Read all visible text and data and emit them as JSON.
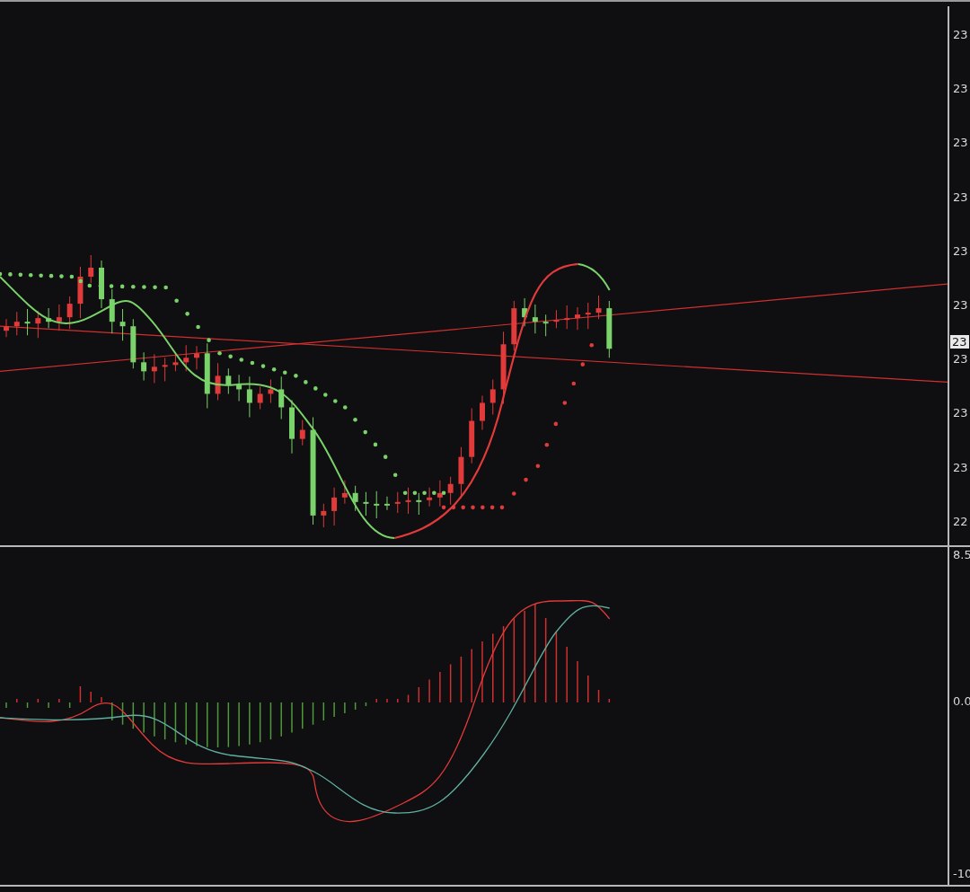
{
  "price_pane": {
    "axis_labels": [
      {
        "text": "23",
        "kind": "tick"
      },
      {
        "text": "23",
        "kind": "tick"
      },
      {
        "text": "23",
        "kind": "tick"
      },
      {
        "text": "23",
        "kind": "tick"
      },
      {
        "text": "23",
        "kind": "tick"
      },
      {
        "text": "23",
        "kind": "tick"
      },
      {
        "text": "23",
        "kind": "current"
      },
      {
        "text": "23",
        "kind": "tick"
      },
      {
        "text": "23",
        "kind": "tick"
      },
      {
        "text": "23",
        "kind": "tick"
      },
      {
        "text": "22",
        "kind": "tick"
      }
    ]
  },
  "macd_pane": {
    "axis_labels": [
      "8.5",
      "0.0",
      "-10"
    ]
  }
}
